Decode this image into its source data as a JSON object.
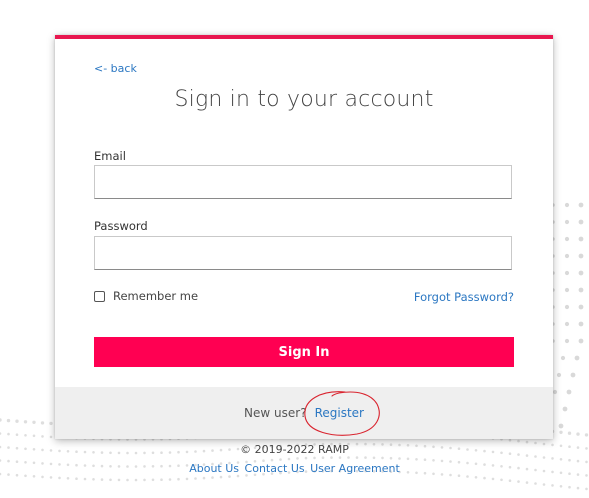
{
  "card": {
    "back_label": "<- back",
    "title": "Sign in to your account",
    "email_label": "Email",
    "email_value": "",
    "password_label": "Password",
    "password_value": "",
    "remember_label": "Remember me",
    "remember_checked": false,
    "forgot_label": "Forgot Password?",
    "signin_label": "Sign In",
    "new_user_text": "New user?",
    "register_label": "Register"
  },
  "footer": {
    "copyright": "© 2019-2022 RAMP",
    "links": [
      "About Us",
      "Contact Us",
      "User Agreement"
    ]
  },
  "colors": {
    "accent": "#ff0052",
    "top_bar": "#e8174f",
    "link": "#2b77c2",
    "annotation": "#d9232e"
  }
}
